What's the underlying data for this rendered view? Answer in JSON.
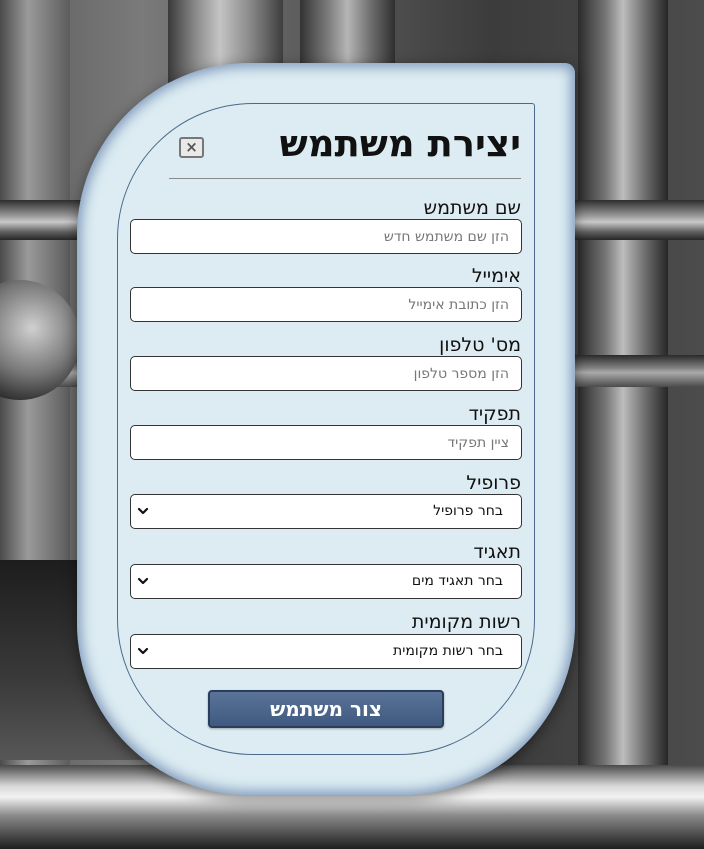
{
  "form": {
    "title": "יצירת משתמש",
    "close_label": "×",
    "fields": [
      {
        "label": "שם משתמש",
        "placeholder": "הזן שם משתמש חדש"
      },
      {
        "label": "אימייל",
        "placeholder": "הזן כתובת אימייל"
      },
      {
        "label": "מס' טלפון",
        "placeholder": "הזן מספר טלפון"
      },
      {
        "label": "תפקיד",
        "placeholder": "ציין תפקיד"
      }
    ],
    "selects": [
      {
        "label": "פרופיל",
        "value": "בחר פרופיל"
      },
      {
        "label": "תאגיד",
        "value": "בחר תאגיד מים"
      },
      {
        "label": "רשות מקומית",
        "value": "בחר רשות מקומית"
      }
    ],
    "submit_label": "צור משתמש"
  },
  "icons": {
    "close": "close-icon",
    "dropdown": "chevron-down-icon"
  },
  "colors": {
    "card_background": "#dcecf2",
    "submit_button": "#4a6388"
  }
}
